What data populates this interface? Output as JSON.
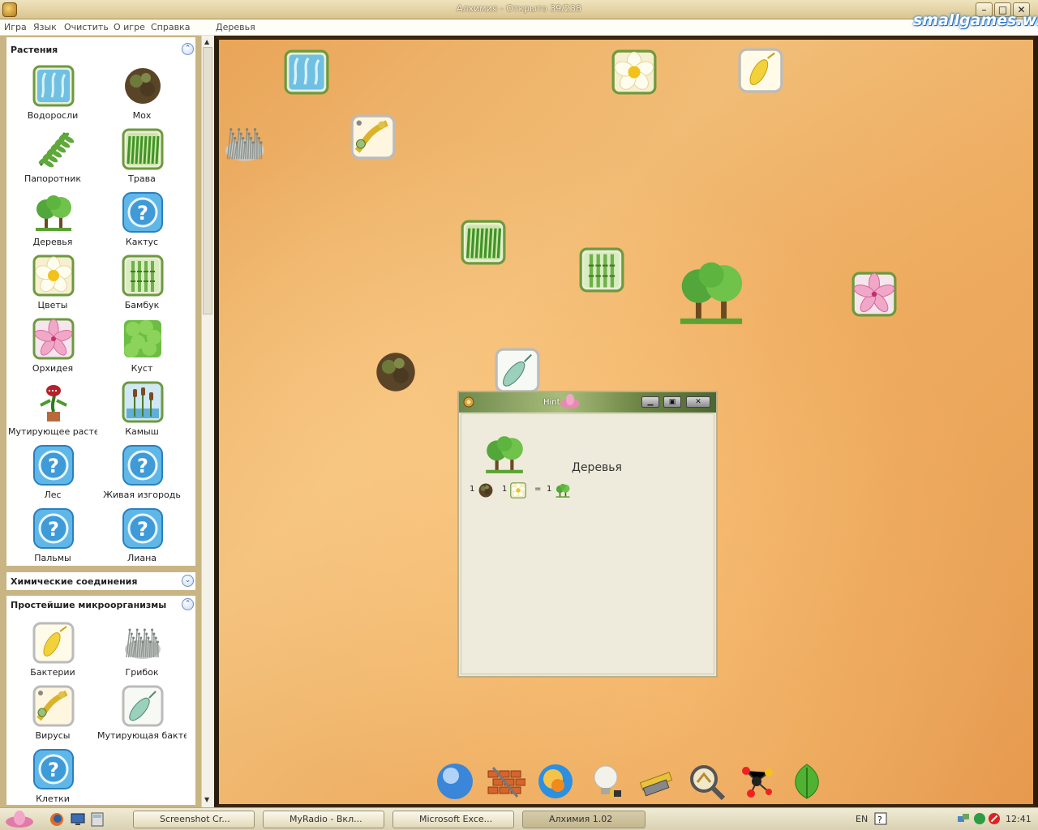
{
  "window": {
    "title": "Алхимия  - Открыто 39/238",
    "buttons": [
      "–",
      "□",
      "✕"
    ]
  },
  "menu": {
    "items": [
      "Игра",
      "Язык",
      "Очистить",
      "О игре",
      "Справка"
    ],
    "current_element": "Деревья",
    "brand": "smallgames.ws"
  },
  "sidebar": {
    "plants": {
      "title": "Растения",
      "toggle": "⌃",
      "items": [
        {
          "label": "Водоросли",
          "icon": "algae-icon"
        },
        {
          "label": "Мох",
          "icon": "moss-icon"
        },
        {
          "label": "Папоротник",
          "icon": "fern-icon"
        },
        {
          "label": "Трава",
          "icon": "grass-icon"
        },
        {
          "label": "Деревья",
          "icon": "trees-icon"
        },
        {
          "label": "Кактус",
          "icon": "unknown-icon"
        },
        {
          "label": "Цветы",
          "icon": "flower-icon"
        },
        {
          "label": "Бамбук",
          "icon": "bamboo-icon"
        },
        {
          "label": "Орхидея",
          "icon": "orchid-icon"
        },
        {
          "label": "Куст",
          "icon": "bush-icon"
        },
        {
          "label": "Мутирующее растени",
          "icon": "mutant-plant-icon"
        },
        {
          "label": "Камыш",
          "icon": "reed-icon"
        },
        {
          "label": "Лес",
          "icon": "unknown-icon"
        },
        {
          "label": "Живая изгородь",
          "icon": "unknown-icon"
        },
        {
          "label": "Пальмы",
          "icon": "unknown-icon"
        },
        {
          "label": "Лиана",
          "icon": "unknown-icon"
        }
      ]
    },
    "chemistry": {
      "title": "Химические соединения",
      "toggle": "⌄"
    },
    "microorganisms": {
      "title": "Простейшие микроорганизмы",
      "toggle": "⌃",
      "items": [
        {
          "label": "Бактерии",
          "icon": "bacteria-icon"
        },
        {
          "label": "Грибок",
          "icon": "fungus-icon"
        },
        {
          "label": "Вирусы",
          "icon": "virus-icon"
        },
        {
          "label": "Мутирующая бактер",
          "icon": "mutant-bacteria-icon"
        },
        {
          "label": "Клетки",
          "icon": "unknown-icon"
        }
      ]
    }
  },
  "board": {
    "elements": [
      {
        "name": "algae-element",
        "icon": "algae-icon"
      },
      {
        "name": "flower-element",
        "icon": "flower-icon"
      },
      {
        "name": "bacteria-element",
        "icon": "bacteria-icon"
      },
      {
        "name": "fungus-element",
        "icon": "fungus-icon"
      },
      {
        "name": "virus-element",
        "icon": "virus-icon"
      },
      {
        "name": "grass-element",
        "icon": "grass-icon"
      },
      {
        "name": "bamboo-element",
        "icon": "bamboo-icon"
      },
      {
        "name": "trees-element",
        "icon": "trees-icon"
      },
      {
        "name": "orchid-element",
        "icon": "orchid-icon"
      },
      {
        "name": "moss-element",
        "icon": "moss-icon"
      },
      {
        "name": "mutant-bacteria-element",
        "icon": "mutant-bacteria-icon"
      }
    ]
  },
  "hint": {
    "title": "Hint",
    "element": "Деревья",
    "recipe": {
      "a_qty": "1",
      "b_qty": "1",
      "op": "=",
      "result_qty": "1"
    }
  },
  "toolbar": [
    "sphere-icon",
    "bricks-icon",
    "atom-icon",
    "lightbulb-icon",
    "tools-icon",
    "magnifier-icon",
    "molecule-icon",
    "leaf-icon"
  ],
  "taskbar": {
    "tasks": [
      "Screenshot Cr...",
      "MyRadio - Вкл...",
      "Microsoft Exce...",
      "Алхимия 1.02"
    ],
    "tray": {
      "lang": "EN",
      "time": "12:41"
    }
  },
  "colors": {
    "accent": "#6f8fc7",
    "board": "#eeaf64",
    "panel_bg": "#c9b583"
  }
}
